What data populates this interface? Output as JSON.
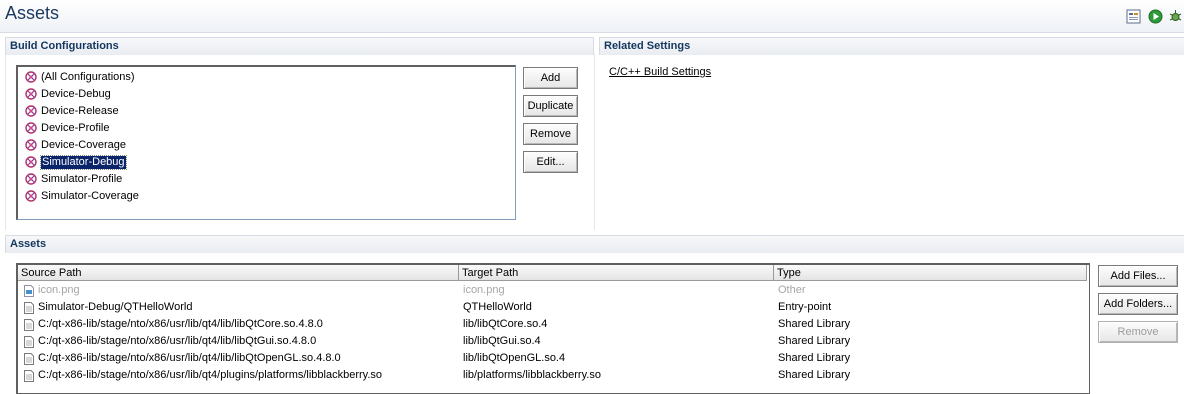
{
  "header": {
    "title": "Assets"
  },
  "build_config": {
    "title": "Build Configurations",
    "items": [
      {
        "label": "(All Configurations)",
        "selected": false
      },
      {
        "label": "Device-Debug",
        "selected": false
      },
      {
        "label": "Device-Release",
        "selected": false
      },
      {
        "label": "Device-Profile",
        "selected": false
      },
      {
        "label": "Device-Coverage",
        "selected": false
      },
      {
        "label": "Simulator-Debug",
        "selected": true
      },
      {
        "label": "Simulator-Profile",
        "selected": false
      },
      {
        "label": "Simulator-Coverage",
        "selected": false
      }
    ],
    "buttons": {
      "add": "Add",
      "duplicate": "Duplicate",
      "remove": "Remove",
      "edit": "Edit..."
    }
  },
  "related": {
    "title": "Related Settings",
    "link": "C/C++ Build Settings"
  },
  "assets": {
    "title": "Assets",
    "columns": [
      "Source Path",
      "Target Path",
      "Type"
    ],
    "rows": [
      {
        "source": "icon.png",
        "target": "icon.png",
        "type": "Other",
        "disabled": true
      },
      {
        "source": "Simulator-Debug/QTHelloWorld",
        "target": "QTHelloWorld",
        "type": "Entry-point",
        "disabled": false
      },
      {
        "source": "C:/qt-x86-lib/stage/nto/x86/usr/lib/qt4/lib/libQtCore.so.4.8.0",
        "target": "lib/libQtCore.so.4",
        "type": "Shared Library",
        "disabled": false
      },
      {
        "source": "C:/qt-x86-lib/stage/nto/x86/usr/lib/qt4/lib/libQtGui.so.4.8.0",
        "target": "lib/libQtGui.so.4",
        "type": "Shared Library",
        "disabled": false
      },
      {
        "source": "C:/qt-x86-lib/stage/nto/x86/usr/lib/qt4/lib/libQtOpenGL.so.4.8.0",
        "target": "lib/libQtOpenGL.so.4",
        "type": "Shared Library",
        "disabled": false
      },
      {
        "source": "C:/qt-x86-lib/stage/nto/x86/usr/lib/qt4/plugins/platforms/libblackberry.so",
        "target": "lib/platforms/libblackberry.so",
        "type": "Shared Library",
        "disabled": false
      }
    ],
    "buttons": {
      "add_files": "Add Files...",
      "add_folders": "Add Folders...",
      "remove": "Remove"
    }
  },
  "icons": {
    "toolbar": [
      "layout-icon",
      "run-icon",
      "debug-icon"
    ],
    "config_item": "build-config-icon",
    "file": "file-icon",
    "image_file": "image-file-icon"
  },
  "colors": {
    "section_title": "#14375f",
    "selection": "#0a246a",
    "run": "#2e9b3a"
  }
}
